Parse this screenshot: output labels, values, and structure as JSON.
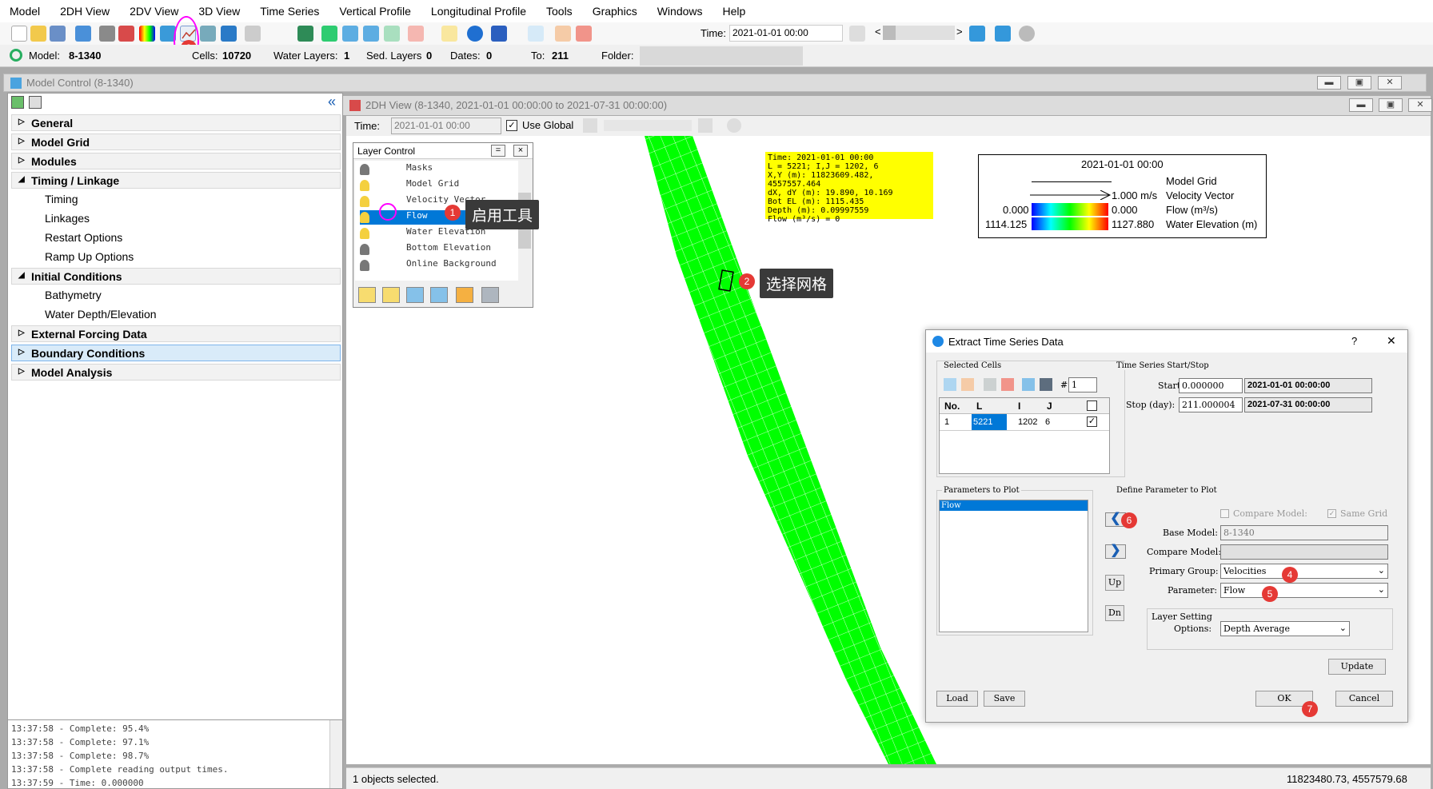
{
  "menu": [
    "Model",
    "2DH View",
    "2DV View",
    "3D View",
    "Time Series",
    "Vertical Profile",
    "Longitudinal Profile",
    "Tools",
    "Graphics",
    "Windows",
    "Help"
  ],
  "toolbar": {
    "time_label": "Time:",
    "time_value": "2021-01-01 00:00",
    "nav_prev": "<",
    "nav_next": ">"
  },
  "infobar": {
    "model_label": "Model:",
    "model_value": "8-1340",
    "cells_label": "Cells:",
    "cells_value": "10720",
    "layers_label": "Water Layers:",
    "layers_value": "1",
    "sed_label": "Sed. Layers",
    "sed_value": "0",
    "dates_label": "Dates:",
    "dates_value": "0",
    "to_label": "To:",
    "to_value": "211",
    "folder_label": "Folder:"
  },
  "model_control": {
    "title": "Model Control (8-1340)",
    "collapse": "«",
    "tree": [
      {
        "label": "General",
        "expanded": false
      },
      {
        "label": "Model Grid",
        "expanded": false
      },
      {
        "label": "Modules",
        "expanded": false
      },
      {
        "label": "Timing / Linkage",
        "expanded": true,
        "children": [
          "Timing",
          "Linkages",
          "Restart Options",
          "Ramp Up Options"
        ]
      },
      {
        "label": "Initial Conditions",
        "expanded": true,
        "children": [
          "Bathymetry",
          "Water Depth/Elevation"
        ]
      },
      {
        "label": "External Forcing Data",
        "expanded": false
      },
      {
        "label": "Boundary Conditions",
        "expanded": false,
        "selected": true
      },
      {
        "label": "Model Analysis",
        "expanded": false
      }
    ],
    "log": [
      "13:37:58 - Complete: 95.4%",
      "13:37:58 - Complete: 97.1%",
      "13:37:58 - Complete: 98.7%",
      "13:37:58 - Complete reading output times.",
      "13:37:59 - Time: 0.000000"
    ]
  },
  "view2dh": {
    "title": "2DH View (8-1340, 2021-01-01 00:00:00 to 2021-07-31 00:00:00)",
    "time_label": "Time:",
    "time_value": "2021-01-01 00:00",
    "use_global": "Use Global",
    "status_left": "1 objects selected.",
    "status_right": "11823480.73, 4557579.68"
  },
  "layer_control": {
    "title": "Layer Control",
    "min": "=",
    "close": "×",
    "layers": [
      "Masks",
      "Model Grid",
      "Velocity Vector",
      "Flow",
      "Water Elevation",
      "Bottom Elevation",
      "Online Background"
    ],
    "selected": "Flow"
  },
  "cell_info": [
    "Time: 2021-01-01 00:00",
    "L = 5221; I,J = 1202, 6",
    "X,Y (m): 11823609.482, 4557557.464",
    "dX, dY (m): 19.890, 10.169",
    "Bot EL (m): 1115.435",
    "Depth (m): 0.09997559",
    "Flow (m³/s) = 0"
  ],
  "legend": {
    "time": "2021-01-01 00:00",
    "grid": "Model Grid",
    "vec_value": "1.000 m/s",
    "vec_label": "Velocity Vector",
    "flow_min": "0.000",
    "flow_max": "0.000",
    "flow_label": "Flow (m³/s)",
    "elev_min": "1114.125",
    "elev_max": "1127.880",
    "elev_label": "Water Elevation (m)"
  },
  "annotations": {
    "step1": "1",
    "step1_text": "启用工具",
    "step2": "2",
    "step2_text": "选择网格",
    "step3": "3",
    "step4": "4",
    "step5": "5",
    "step6": "6",
    "step7": "7"
  },
  "dialog": {
    "title": "Extract Time Series Data",
    "help": "?",
    "close": "✕",
    "selected_cells": "Selected Cells",
    "count_label": "#",
    "count_value": "1",
    "table_headers": [
      "No.",
      "L",
      "I",
      "J"
    ],
    "table_row": {
      "no": "1",
      "L": "5221",
      "I": "1202",
      "J": "6"
    },
    "ts_group": "Time Series Start/Stop",
    "start_label": "Start",
    "start_value": "0.000000",
    "start_date": "2021-01-01 00:00:00",
    "stop_label": "Stop (day):",
    "stop_value": "211.000004",
    "stop_date": "2021-07-31 00:00:00",
    "params_group": "Parameters to Plot",
    "params": [
      "Flow"
    ],
    "up": "Up",
    "dn": "Dn",
    "define_group": "Define Parameter to Plot",
    "compare_model_chk": "Compare Model:",
    "same_grid_chk": "Same Grid",
    "base_model_label": "Base Model:",
    "base_model_value": "8-1340",
    "compare_model_label": "Compare Model:",
    "primary_group_label": "Primary Group:",
    "primary_group_value": "Velocities",
    "parameter_label": "Parameter:",
    "parameter_value": "Flow",
    "layer_setting_label": "Layer Setting",
    "options_label": "Options:",
    "options_value": "Depth Average",
    "update": "Update",
    "load": "Load",
    "save": "Save",
    "ok": "OK",
    "cancel": "Cancel"
  },
  "colors": {
    "grid_green": "#00ff00",
    "select_blue": "#0078d7",
    "badge_red": "#e53935",
    "highlight_magenta": "#ff00ff",
    "yellow": "#ffff00"
  }
}
